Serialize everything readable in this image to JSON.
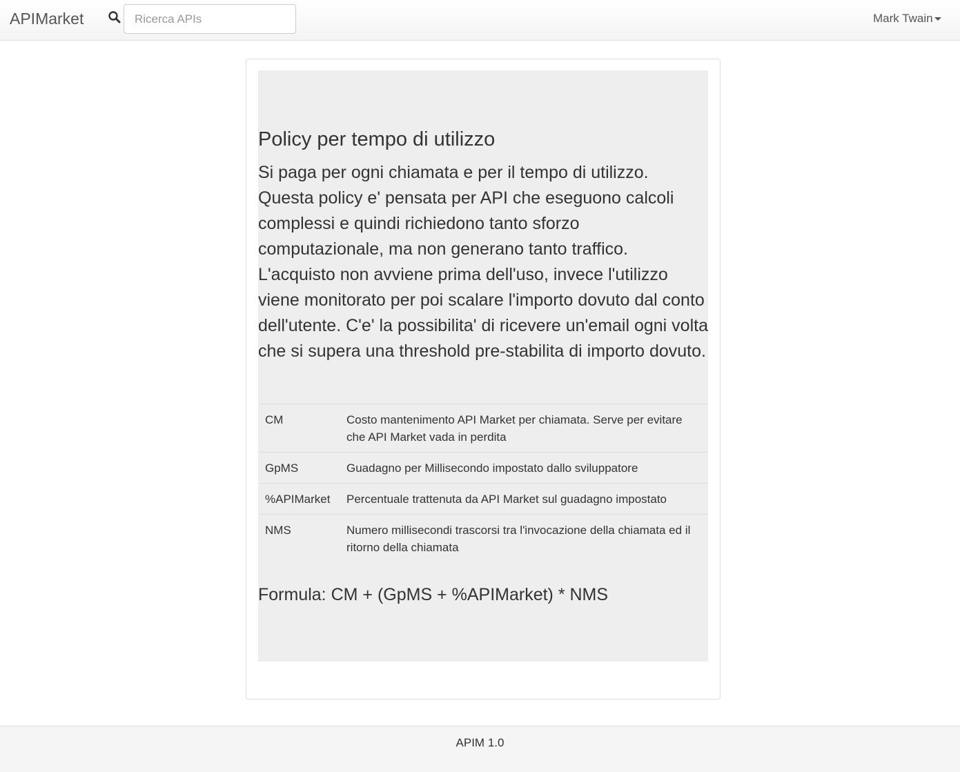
{
  "navbar": {
    "brand": "APIMarket",
    "search": {
      "placeholder": "Ricerca APIs",
      "value": "",
      "icon": "search-icon"
    },
    "user": {
      "name": "Mark Twain",
      "icon": "caret-down-icon"
    }
  },
  "policy": {
    "title": "Policy per tempo di utilizzo",
    "description": "Si paga per ogni chiamata e per il tempo di utilizzo. Questa policy e' pensata per API che eseguono calcoli complessi e quindi richiedono tanto sforzo computazionale, ma non generano tanto traffico. L'acquisto non avviene prima dell'uso, invece l'utilizzo viene monitorato per poi scalare l'importo dovuto dal conto dell'utente. C'e' la possibilita' di ricevere un'email ogni volta che si supera una threshold pre-stabilita di importo dovuto.",
    "variables": [
      {
        "name": "CM",
        "description": "Costo mantenimento API Market per chiamata. Serve per evitare che API Market vada in perdita"
      },
      {
        "name": "GpMS",
        "description": "Guadagno per Millisecondo impostato dallo sviluppatore"
      },
      {
        "name": "%APIMarket",
        "description": "Percentuale trattenuta da API Market sul guadagno impostato"
      },
      {
        "name": "NMS",
        "description": "Numero millisecondi trascorsi tra l'invocazione della chiamata ed il ritorno della chiamata"
      }
    ],
    "formula": "Formula: CM + (GpMS + %APIMarket) * NMS"
  },
  "footer": {
    "text": "APIM 1.0"
  },
  "colors": {
    "jumbotron_bg": "#eeeeee",
    "text": "#333333",
    "navbar_text": "#555555",
    "footer_bg": "#f5f5f5"
  }
}
